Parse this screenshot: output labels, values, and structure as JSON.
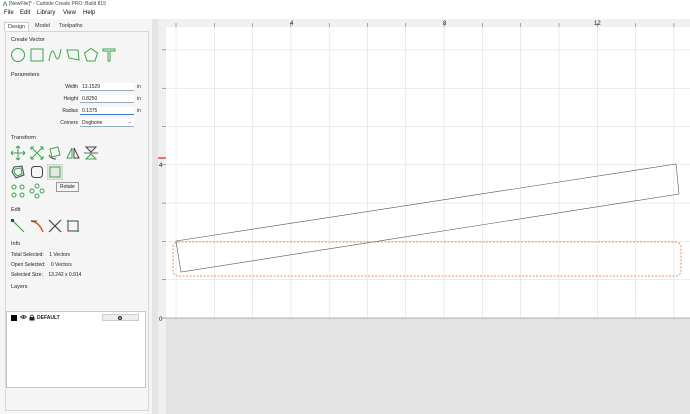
{
  "window": {
    "title": "[NewFile]* - Carbide Create PRO: Build 815"
  },
  "menu": {
    "items": [
      "File",
      "Edit",
      "Library",
      "View",
      "Help"
    ]
  },
  "tabs": [
    "Design",
    "Model",
    "Toolpaths"
  ],
  "create_vector": {
    "title": "Create Vector",
    "tools": [
      "circle-icon",
      "rectangle-icon",
      "curve-icon",
      "polygon-icon",
      "pentagon-icon",
      "text-icon"
    ]
  },
  "parameters": {
    "title": "Parameters",
    "width_label": "Width",
    "width_value": "13.1529",
    "width_unit": "in",
    "height_label": "Height",
    "height_value": "0.8250",
    "height_unit": "in",
    "radius_label": "Radius",
    "radius_value": "0.1375",
    "radius_unit": "in",
    "corners_label": "Corners",
    "corners_value": "Dogbone"
  },
  "transform": {
    "title": "Transform",
    "tooltip": "Rotate"
  },
  "edit": {
    "title": "Edit"
  },
  "info": {
    "title": "Info",
    "total_selected_label": "Total Selected:",
    "total_selected_value": "1 Vectors",
    "open_selected_label": "Open Selected:",
    "open_selected_value": "0 Vectors",
    "selected_size_label": "Selected Size:",
    "selected_size_value": "13.242 x 0.914"
  },
  "layers": {
    "title": "Layers",
    "items": [
      {
        "name": "DEFAULT",
        "color": "#000000"
      }
    ]
  },
  "ruler": {
    "top_labels": [
      "4",
      "8",
      "12"
    ],
    "left_labels": [
      "4",
      "0"
    ]
  },
  "colors": {
    "accent_green": "#3aa64a",
    "selection_orange": "#f26b1d",
    "origin_red": "#e02020"
  }
}
